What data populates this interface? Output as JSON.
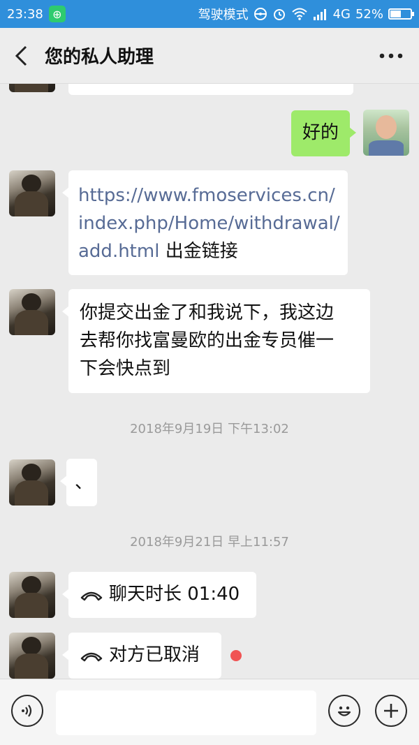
{
  "status_bar": {
    "time": "23:38",
    "app_icon": "wechat-notification-icon",
    "driving_mode": "驾驶模式",
    "network": "4G",
    "battery": "52%",
    "battery_level": 0.52
  },
  "header": {
    "title": "您的私人助理",
    "back_icon": "chevron-left-icon",
    "more_icon": "more-dots-icon"
  },
  "messages": {
    "m1": {
      "sender": "me",
      "text": "好的"
    },
    "m2": {
      "sender": "assistant",
      "link_text": [
        "https://www.fmoservices.cn/",
        "index.php/Home/withdrawal/",
        "add.html"
      ],
      "suffix": "出金链接"
    },
    "m3": {
      "sender": "assistant",
      "lines": [
        "你提交出金了和我说下，我这边",
        "去帮你找富曼欧的出金专员催一",
        "下会快点到"
      ]
    },
    "ts1": "2018年9月19日 下午13:02",
    "m4": {
      "sender": "assistant",
      "text": "、"
    },
    "ts2": "2018年9月21日 早上11:57",
    "m5": {
      "sender": "assistant",
      "icon": "phone-hangup-icon",
      "text": "聊天时长 01:40"
    },
    "m6": {
      "sender": "assistant",
      "icon": "phone-hangup-icon",
      "text": "对方已取消",
      "unread": true
    }
  },
  "input_bar": {
    "voice_icon": "voice-icon",
    "emoji_icon": "emoji-icon",
    "plus_icon": "plus-icon",
    "placeholder": ""
  },
  "colors": {
    "status_bar": "#2f8fdb",
    "my_bubble": "#9eea6a",
    "link": "#576b95",
    "unread_dot": "#f05454"
  }
}
